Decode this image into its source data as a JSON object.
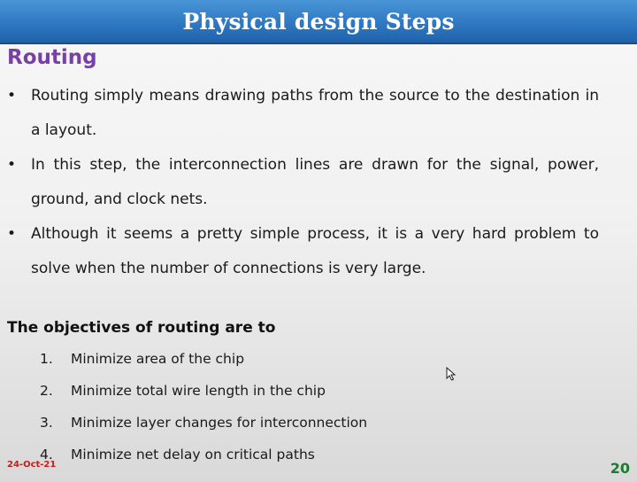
{
  "slide": {
    "title": "Physical design Steps",
    "section_heading": "Routing",
    "bullets": [
      "Routing simply means drawing paths from the source to the destination in a layout.",
      "In this step, the interconnection lines are drawn for the signal, power, ground, and clock nets.",
      "Although it seems a pretty simple process, it is a very hard problem to solve when the number of connections is very large."
    ],
    "objectives_heading": "The objectives of routing are to",
    "objectives": [
      {
        "num": "1.",
        "text": "Minimize area of the chip"
      },
      {
        "num": "2.",
        "text": "Minimize total wire length in the chip"
      },
      {
        "num": "3.",
        "text": "Minimize layer changes for interconnection"
      },
      {
        "num": "4.",
        "text": "Minimize  net delay on critical paths"
      }
    ],
    "date": "24-Oct-21",
    "page_number": "20"
  },
  "colors": {
    "title_bar": "#2f78c2",
    "section_heading": "#7a3fa6",
    "date": "#c02020",
    "page_number": "#1d7a2e"
  }
}
